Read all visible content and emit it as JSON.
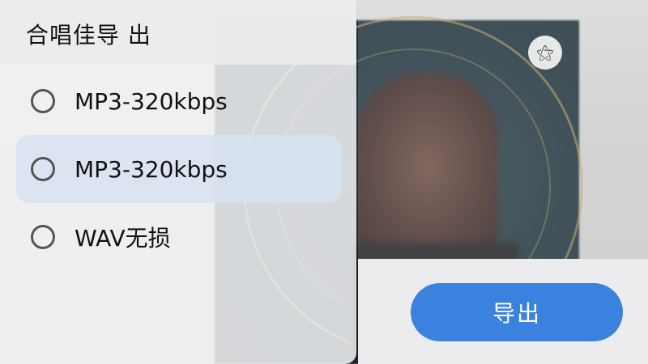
{
  "dialog": {
    "title": "合唱佳导 出"
  },
  "options": [
    {
      "label": "MP3-320kbps",
      "selected": false
    },
    {
      "label": "MP3-320kbps",
      "selected": true
    },
    {
      "label": "WAV无损",
      "selected": false
    }
  ],
  "preview": {
    "badge_icon": "share-icon",
    "badge_glyph": "⚝"
  },
  "export_button": {
    "label": "导出"
  },
  "colors": {
    "accent": "#3b82df",
    "selected_row": "#d7e2f0"
  }
}
